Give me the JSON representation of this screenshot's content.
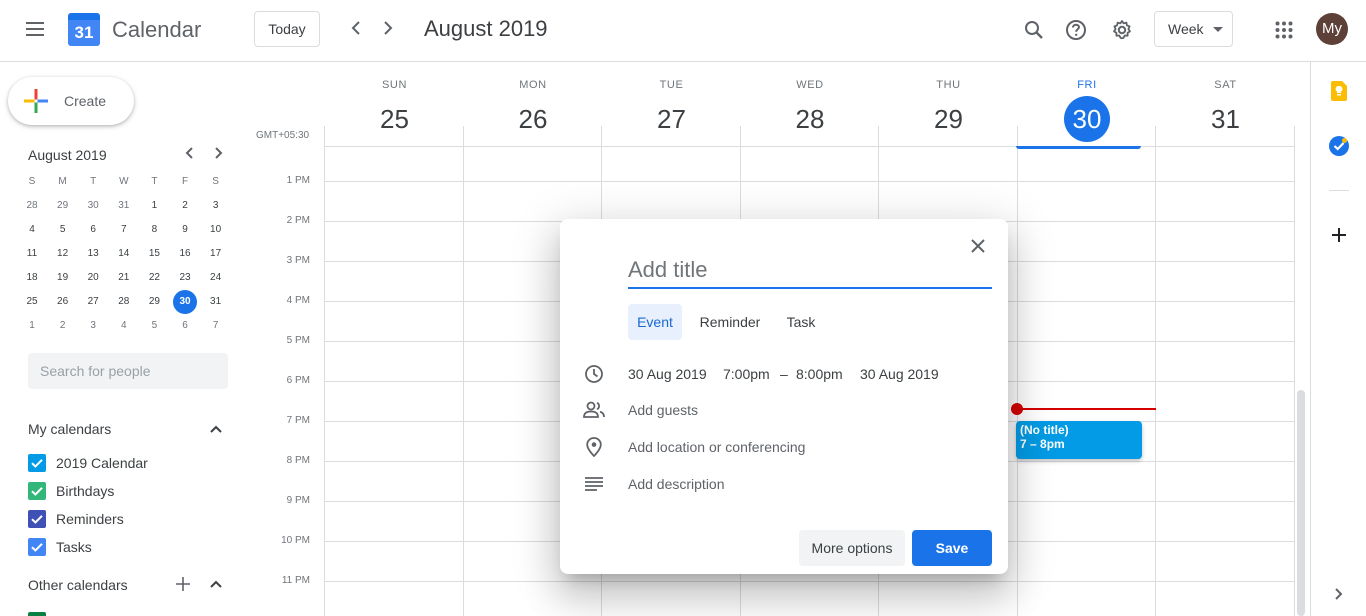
{
  "app": {
    "logo_number": "31",
    "title": "Calendar"
  },
  "header": {
    "today_label": "Today",
    "prev_icon": "chevron-left-icon",
    "next_icon": "chevron-right-icon",
    "date_range": "August 2019",
    "view_selected": "Week",
    "avatar_initials": "My",
    "avatar_color": "#5d4037"
  },
  "sidebar": {
    "create_label": "Create",
    "mini_calendar": {
      "title": "August 2019",
      "weekdays": [
        "S",
        "M",
        "T",
        "W",
        "T",
        "F",
        "S"
      ],
      "weeks": [
        [
          "28",
          "29",
          "30",
          "31",
          "1",
          "2",
          "3"
        ],
        [
          "4",
          "5",
          "6",
          "7",
          "8",
          "9",
          "10"
        ],
        [
          "11",
          "12",
          "13",
          "14",
          "15",
          "16",
          "17"
        ],
        [
          "18",
          "19",
          "20",
          "21",
          "22",
          "23",
          "24"
        ],
        [
          "25",
          "26",
          "27",
          "28",
          "29",
          "30",
          "31"
        ],
        [
          "1",
          "2",
          "3",
          "4",
          "5",
          "6",
          "7"
        ]
      ],
      "selected": "30"
    },
    "search_placeholder": "Search for people",
    "my_calendars_title": "My calendars",
    "my_calendars": [
      {
        "label": "2019 Calendar",
        "color": "#039be5"
      },
      {
        "label": "Birthdays",
        "color": "#33b679"
      },
      {
        "label": "Reminders",
        "color": "#3f51b5"
      },
      {
        "label": "Tasks",
        "color": "#4285f4"
      }
    ],
    "other_calendars_title": "Other calendars"
  },
  "week": {
    "timezone": "GMT+05:30",
    "days": [
      {
        "dow": "SUN",
        "num": "25"
      },
      {
        "dow": "MON",
        "num": "26"
      },
      {
        "dow": "TUE",
        "num": "27"
      },
      {
        "dow": "WED",
        "num": "28"
      },
      {
        "dow": "THU",
        "num": "29"
      },
      {
        "dow": "FRI",
        "num": "30",
        "today": true
      },
      {
        "dow": "SAT",
        "num": "31"
      }
    ],
    "hours": [
      "1 PM",
      "2 PM",
      "3 PM",
      "4 PM",
      "5 PM",
      "6 PM",
      "7 PM",
      "8 PM",
      "9 PM",
      "10 PM",
      "11 PM"
    ],
    "event": {
      "title": "(No title)",
      "time": "7 – 8pm",
      "color": "#039be5"
    }
  },
  "dialog": {
    "title_placeholder": "Add title",
    "tabs": [
      "Event",
      "Reminder",
      "Task"
    ],
    "active_tab": "Event",
    "start_date": "30 Aug 2019",
    "start_time": "7:00pm",
    "dash": "–",
    "end_time": "8:00pm",
    "end_date": "30 Aug 2019",
    "guests": "Add guests",
    "location": "Add location or conferencing",
    "description": "Add description",
    "more_options": "More options",
    "save": "Save"
  },
  "colors": {
    "accent": "#1a73e8",
    "now_line": "#d50000"
  }
}
